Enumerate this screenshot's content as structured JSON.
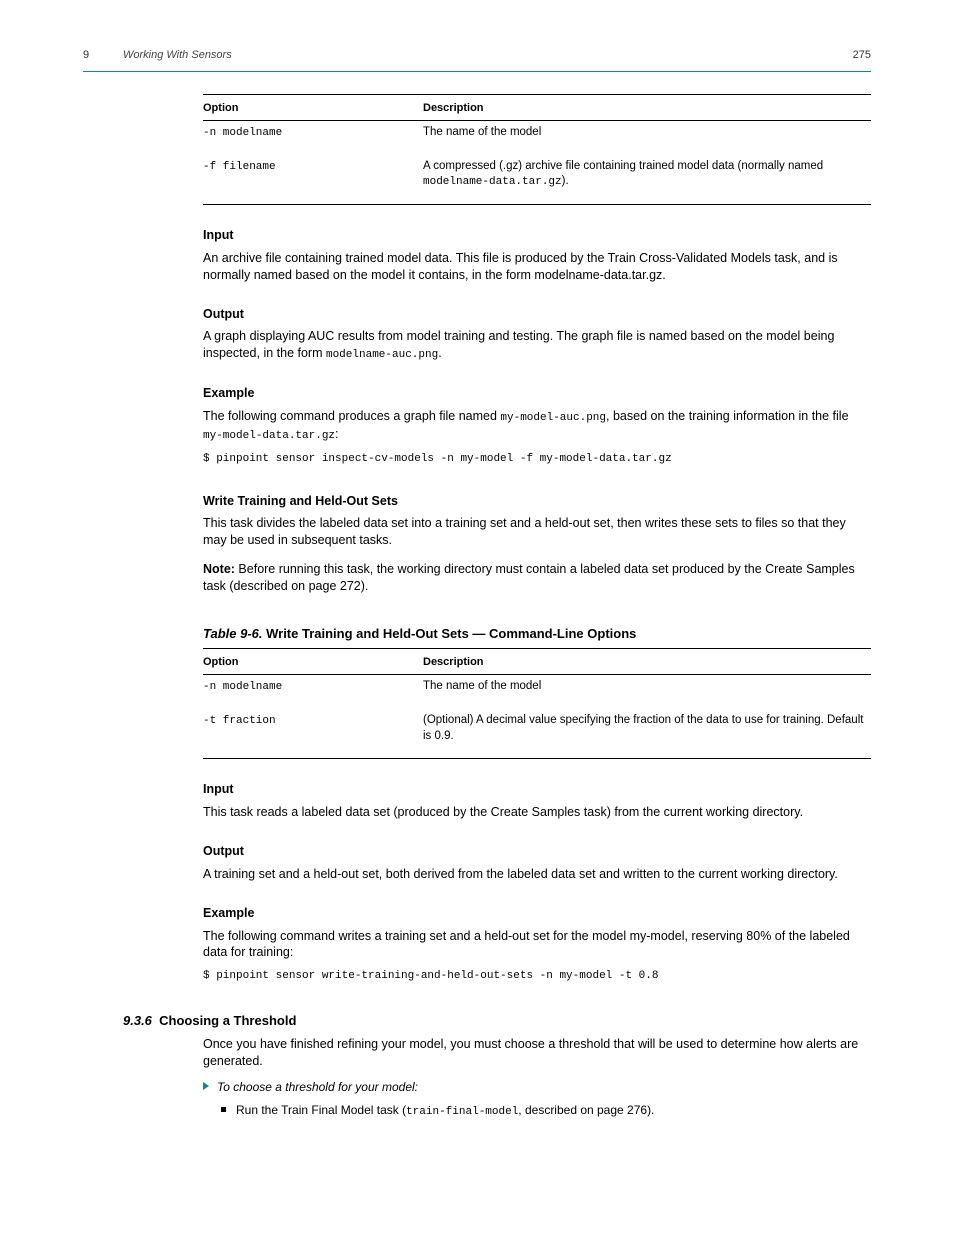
{
  "header": {
    "chapter": "9",
    "title": "Working With Sensors",
    "page": "275"
  },
  "table1": {
    "col1": "Option",
    "col2": "Description",
    "row1_opt": "-n modelname",
    "row1_desc": "The name of the model",
    "row2_opt": "-f filename",
    "row2_desc_a": "A compressed (.gz) archive file containing trained model data (normally named ",
    "row2_desc_mono": "modelname-data.tar.gz",
    "row2_desc_b": ")."
  },
  "sect_input": {
    "head": "Input",
    "body": "An archive file containing trained model data. This file is produced by the Train Cross-Validated Models task, and is normally named based on the model it contains, in the form modelname-data.tar.gz."
  },
  "sect_output": {
    "head": "Output",
    "body_a": "A graph displaying AUC results from model training and testing. The graph file is named based on the model being inspected, in the form ",
    "body_mono": "modelname-auc.png",
    "body_b": "."
  },
  "sect_example": {
    "head": "Example",
    "body_a": "The following command produces a graph file named ",
    "body_mono_a": "my-model-auc.png",
    "body_b": ", based on the training information in the file ",
    "body_mono_b": "my-model-data.tar.gz",
    "body_c": ":",
    "cmd": "$ pinpoint sensor inspect-cv-models -n my-model -f my-model-data.tar.gz"
  },
  "sect_write": {
    "head": "Write Training and Held-Out Sets",
    "body": "This task divides the labeled data set into a training set and a held-out set, then writes these sets to files so that they may be used in subsequent tasks.",
    "note_head": "Note:",
    "note_body": " Before running this task, the working directory must contain a labeled data set produced by the Create Samples task (described on page 272)."
  },
  "caption2": {
    "label": "Table 9-6.",
    "text": " Write Training and Held-Out Sets — Command-Line Options"
  },
  "table2": {
    "col1": "Option",
    "col2": "Description",
    "row1_opt": "-n modelname",
    "row1_desc": "The name of the model",
    "row2_opt": "-t fraction",
    "row2_desc": "(Optional) A decimal value specifying the fraction of the data to use for training. Default is 0.9."
  },
  "sect_t2_input": {
    "head": "Input",
    "body": "This task reads a labeled data set (produced by the Create Samples task) from the current working directory."
  },
  "sect_t2_output": {
    "head": "Output",
    "body": "A training set and a held-out set, both derived from the labeled data set and written to the current working directory."
  },
  "sect_t2_example": {
    "head": "Example",
    "body": "The following command writes a training set and a held-out set for the model my-model, reserving 80% of the labeled data for training:",
    "cmd": "$ pinpoint sensor write-training-and-held-out-sets -n my-model -t 0.8"
  },
  "sect_936": {
    "num": "9.3.6",
    "title": "Choosing a Threshold",
    "body": "Once you have finished refining your model, you must choose a threshold that will be used to determine how alerts are generated.",
    "proc": "To choose a threshold for your model:",
    "bullet_a": "Run the Train Final Model task (",
    "bullet_mono": "train-final-model",
    "bullet_b": ", described on page 276)."
  }
}
